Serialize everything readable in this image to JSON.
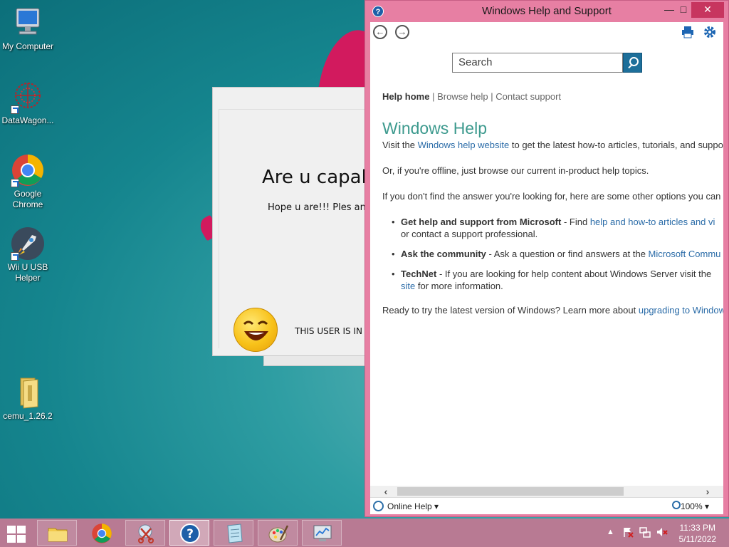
{
  "desktop": {
    "icons": [
      {
        "label": "My Computer"
      },
      {
        "label": "DataWagon..."
      },
      {
        "label": "Google Chrome"
      },
      {
        "label": "Wii U USB Helper"
      },
      {
        "label": "cemu_1.26.2"
      }
    ]
  },
  "prank_dialog": {
    "heading": "Are u capab",
    "subtext": "Hope u are!!! Ples answe",
    "user_text": "THIS USER IS IN"
  },
  "help_window": {
    "title": "Windows Help and Support",
    "controls": {
      "minimize": "—",
      "maximize": "□",
      "close": "✕"
    },
    "search_placeholder": "Search",
    "breadcrumb": {
      "home": "Help home",
      "sep": " | ",
      "browse": "Browse help",
      "contact": "Contact support"
    },
    "heading": "Windows Help",
    "visit_pre": "Visit the ",
    "visit_link": "Windows help website",
    "visit_post": " to get the latest how-to articles, tutorials, and suppo",
    "offline": "Or, if you're offline, just browse our current in-product help topics.",
    "options_intro": "If you don't find the answer you're looking for, here are some other options you can",
    "bullets": [
      {
        "bold": "Get help and support from Microsoft",
        "text": " - Find ",
        "link": "help and how-to articles and vi",
        "line2": "or contact a support professional."
      },
      {
        "bold": "Ask the community",
        "text": " - Ask a question or find answers at the ",
        "link": "Microsoft Commu"
      },
      {
        "bold": "TechNet",
        "text": " - If you are looking for help content about Windows Server visit the ",
        "line2_link": "site",
        "line2": " for more information."
      }
    ],
    "ready_pre": "Ready to try the latest version of Windows? Learn more about ",
    "ready_link": "upgrading to Window",
    "status_left": "Online Help ▾",
    "zoom": "100% ▾"
  },
  "taskbar": {
    "buttons": [
      "file-explorer",
      "google-chrome",
      "snipping-tool",
      "windows-help",
      "notepad",
      "paint",
      "system-info"
    ],
    "active": "windows-help",
    "time": "11:33 PM",
    "date": "5/11/2022"
  }
}
